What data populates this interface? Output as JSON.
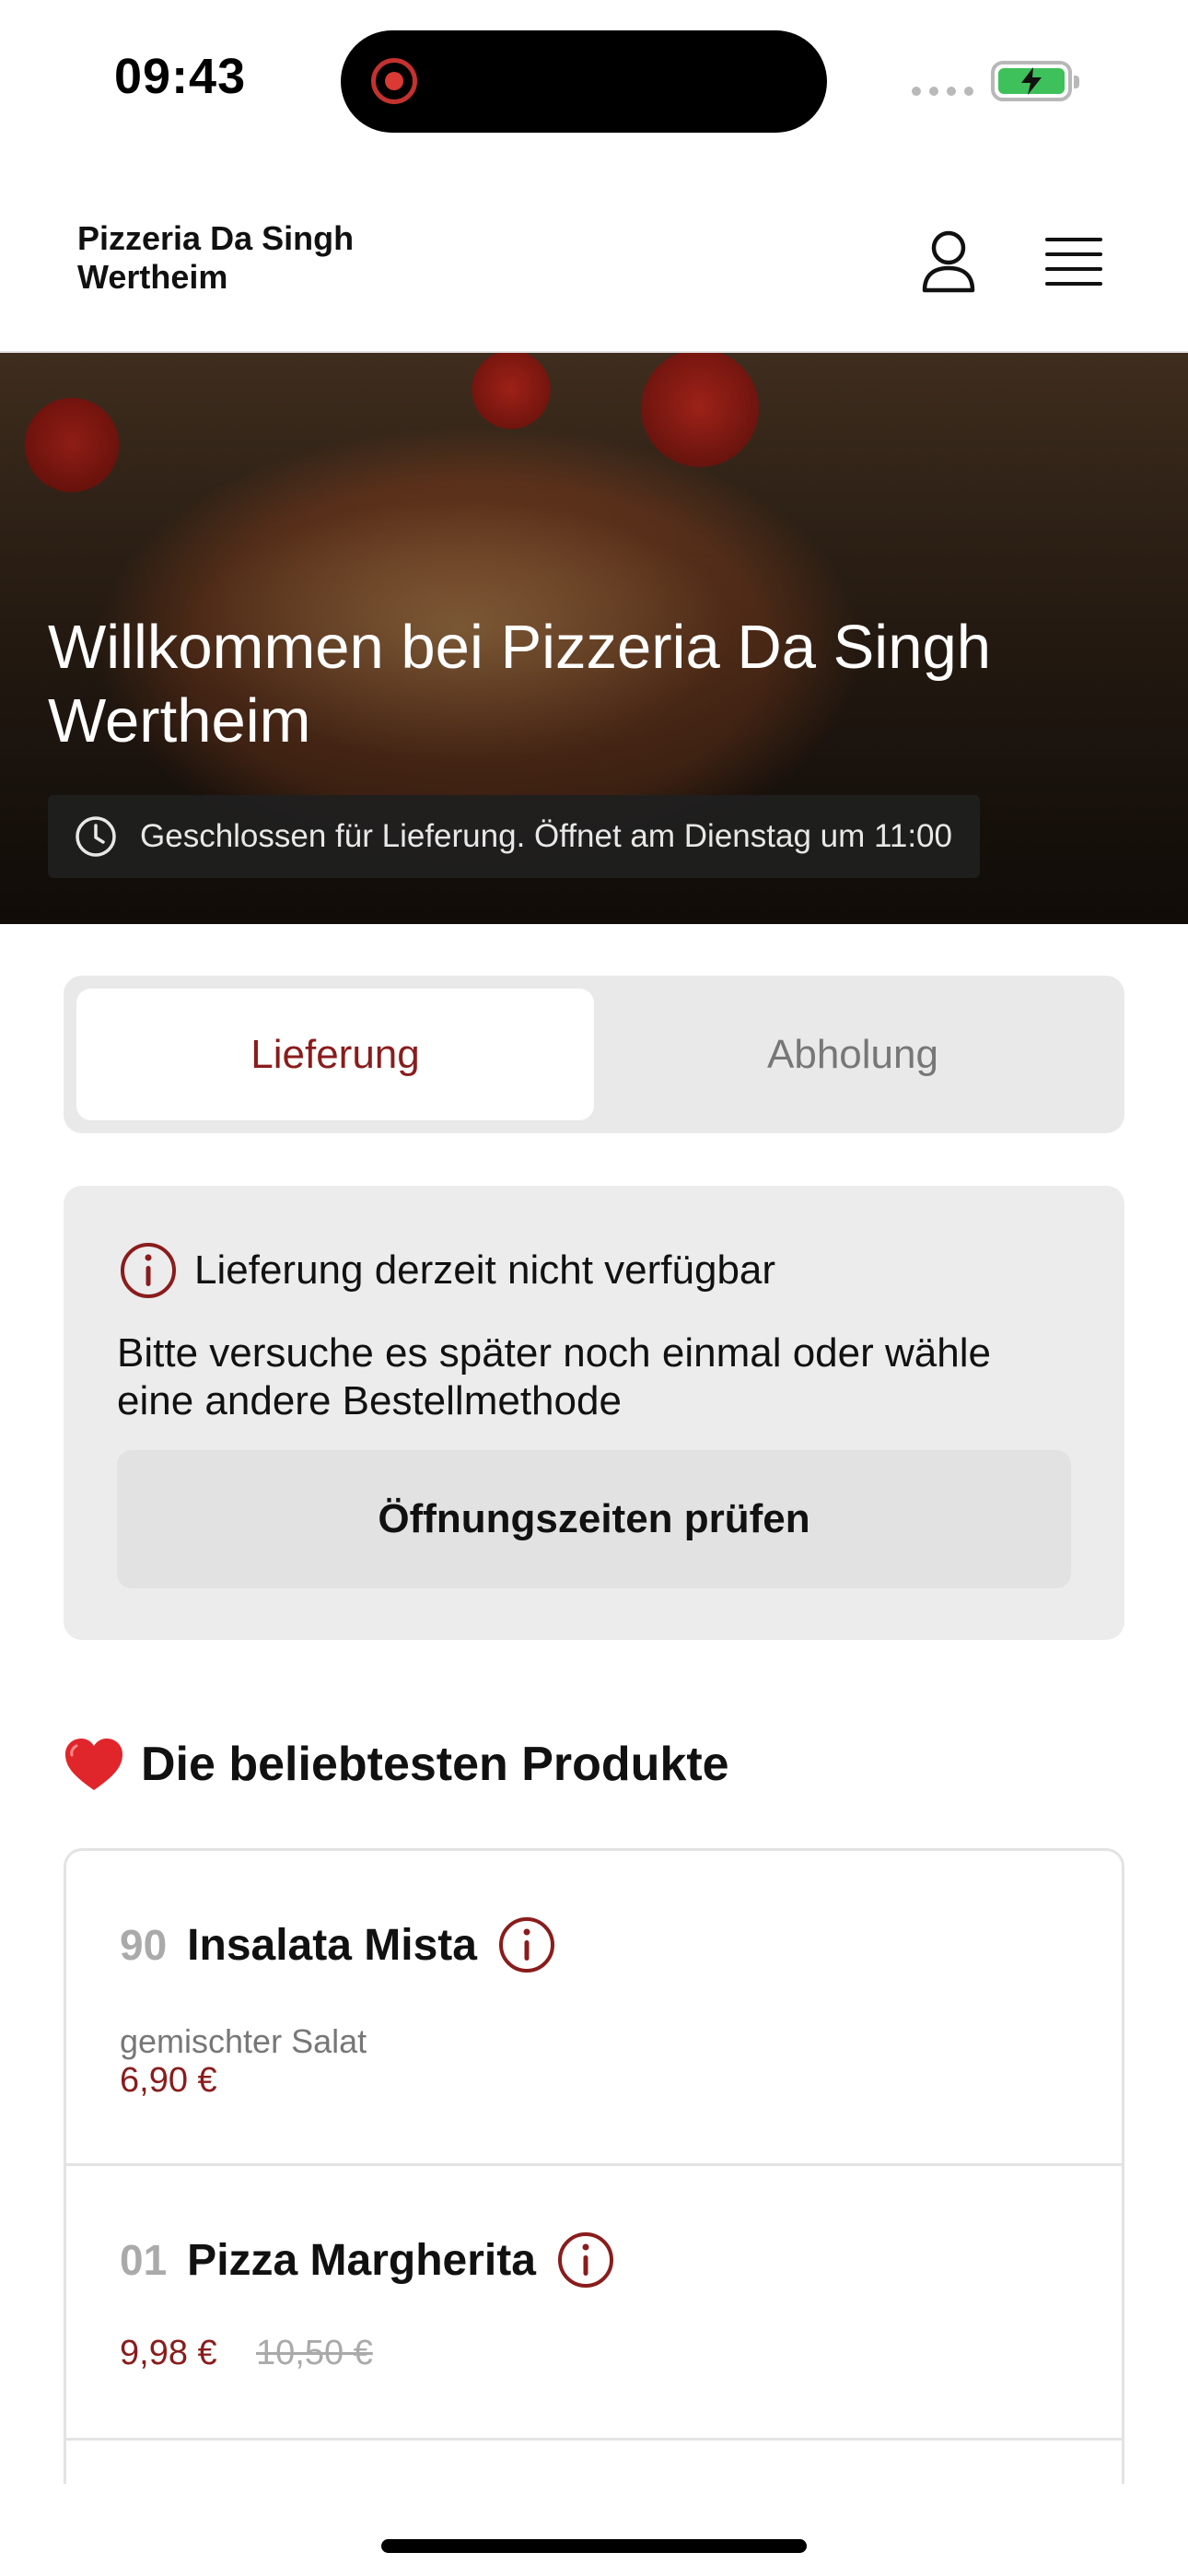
{
  "status_bar": {
    "time": "09:43",
    "battery_color": "#3ec15a",
    "record_color": "#d93a33"
  },
  "header": {
    "brand_line1": "Pizzeria Da Singh",
    "brand_line2": "Wertheim",
    "icons": [
      "user-icon",
      "hamburger-menu-icon"
    ]
  },
  "hero": {
    "title_line1": "Willkommen bei Pizzeria Da Singh",
    "title_line2": "Wertheim",
    "status_text": "Geschlossen für Lieferung. Öffnet am Dienstag um 11:00",
    "status_icon": "clock-icon"
  },
  "tabs": [
    {
      "label": "Lieferung",
      "active": true
    },
    {
      "label": "Abholung",
      "active": false
    }
  ],
  "notice": {
    "title": "Lieferung derzeit nicht verfügbar",
    "body_line1": "Bitte versuche es später noch einmal oder wähle",
    "body_line2": "eine andere Bestellmethode",
    "button_label": "Öffnungszeiten prüfen",
    "icon": "info-circle-icon"
  },
  "popular": {
    "title": "Die beliebtesten Produkte",
    "icon": "red-heart-icon",
    "products": [
      {
        "number": "90",
        "name": "Insalata Mista",
        "description": "gemischter Salat",
        "price": "6,90 €"
      },
      {
        "number": "01",
        "name": "Pizza Margherita",
        "price": "9,98 €",
        "old_price": "10,50 €"
      }
    ]
  },
  "colors": {
    "accent": "#8a1c1c",
    "muted": "#777777",
    "panel": "#ececec"
  }
}
